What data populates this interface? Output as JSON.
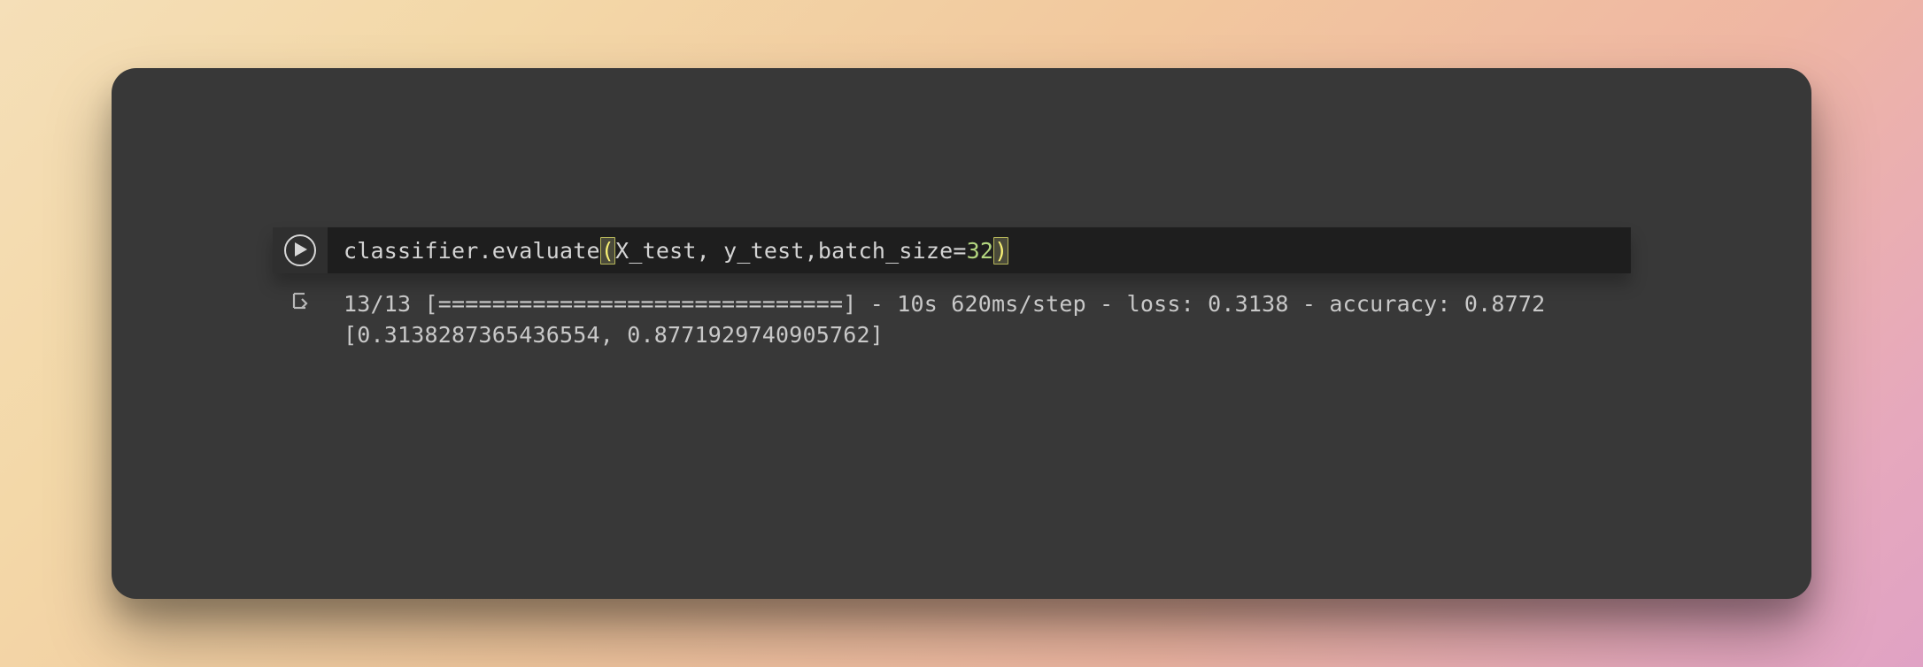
{
  "cell": {
    "code": {
      "object": "classifier",
      "call": "evaluate",
      "open_paren": "(",
      "arg1": "X_test",
      "sep1": ", ",
      "arg2": "y_test",
      "sep2": ",",
      "kwarg": "batch_size",
      "eq": "=",
      "kwval": "32",
      "close_paren": ")"
    },
    "output": {
      "line1": "13/13 [==============================] - 10s 620ms/step - loss: 0.3138 - accuracy: 0.8772",
      "line2": "[0.3138287365436554, 0.8771929740905762]"
    }
  }
}
